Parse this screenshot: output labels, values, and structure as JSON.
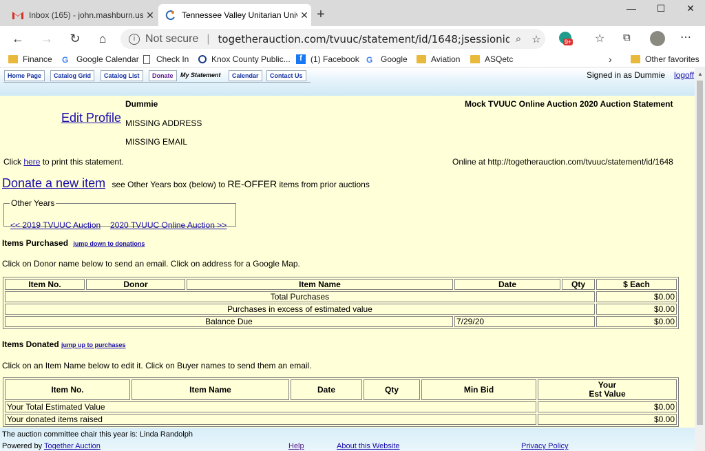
{
  "browser": {
    "tabs": [
      {
        "title": "Inbox (165) - john.mashburn.us@",
        "icon": "gmail-icon"
      },
      {
        "title": "Tennessee Valley Unitarian Unive",
        "icon": "auction-icon"
      }
    ],
    "address": {
      "security": "Not secure",
      "url": "togetherauction.com/tvuuc/statement/id/1648;jsessionid=gbl..."
    },
    "profile_badge": "9+",
    "bookmarks": [
      {
        "label": "Finance",
        "icon": "folder-icon"
      },
      {
        "label": "Google Calendar",
        "icon": "google-icon"
      },
      {
        "label": "Check In",
        "icon": "page-icon"
      },
      {
        "label": "Knox County Public...",
        "icon": "circle-icon"
      },
      {
        "label": "(1) Facebook",
        "icon": "facebook-icon"
      },
      {
        "label": "Google",
        "icon": "google-icon"
      },
      {
        "label": "Aviation",
        "icon": "folder-icon"
      },
      {
        "label": "ASQetc",
        "icon": "folder-icon"
      }
    ],
    "other_favorites": "Other favorites"
  },
  "nav": {
    "tabs": [
      "Home Page",
      "Catalog Grid",
      "Catalog List",
      "Donate",
      "My Statement",
      "Calendar",
      "Contact Us"
    ],
    "signed_in": "Signed in as Dummie",
    "logoff": "logoff"
  },
  "profile": {
    "edit_link": "Edit Profile",
    "name": "Dummie",
    "address": "MISSING ADDRESS",
    "email": "MISSING EMAIL",
    "statement_title": "Mock TVUUC Online Auction 2020 Auction Statement"
  },
  "print": {
    "prefix": "Click",
    "link": "here",
    "suffix": "to print this statement.",
    "online_at": "Online at http://togetherauction.com/tvuuc/statement/id/1648"
  },
  "donate": {
    "link": "Donate a new item",
    "text_a": "see Other Years box (below) to",
    "text_b": "RE-OFFER",
    "text_c": "items from prior auctions"
  },
  "other_years": {
    "legend": "Other Years",
    "prev": "<< 2019 TVUUC Auction",
    "next": "2020 TVUUC Online Auction >>"
  },
  "purchased": {
    "heading": "Items Purchased",
    "jump": "jump down to donations",
    "instructions": "Click on Donor name below to send an email. Click on address for a Google Map.",
    "columns": [
      "Item No.",
      "Donor",
      "Item Name",
      "Date",
      "Qty",
      "$ Each"
    ],
    "total_label": "Total Purchases",
    "total_value": "$0.00",
    "excess_label": "Purchases in excess of estimated value",
    "excess_value": "$0.00",
    "balance_label": "Balance Due",
    "balance_date": "7/29/20",
    "balance_value": "$0.00"
  },
  "donated": {
    "heading": "Items Donated",
    "jump": "jump up to purchases",
    "instructions": "Click on an Item Name below to edit it. Click on Buyer names to send them an email.",
    "columns": [
      "Item No.",
      "Item Name",
      "Date",
      "Qty",
      "Min Bid"
    ],
    "est_col_a": "Your",
    "est_col_b": "Est Value",
    "total_label": "Your Total Estimated Value",
    "total_value": "$0.00",
    "raised_label": "Your donated items raised",
    "raised_value": "$0.00"
  },
  "footer": {
    "chair": "The auction committee chair this year is: Linda Randolph",
    "powered_prefix": "Powered by",
    "powered_link": "Together Auction",
    "help": "Help",
    "about": "About this Website",
    "privacy": "Privacy Policy"
  }
}
